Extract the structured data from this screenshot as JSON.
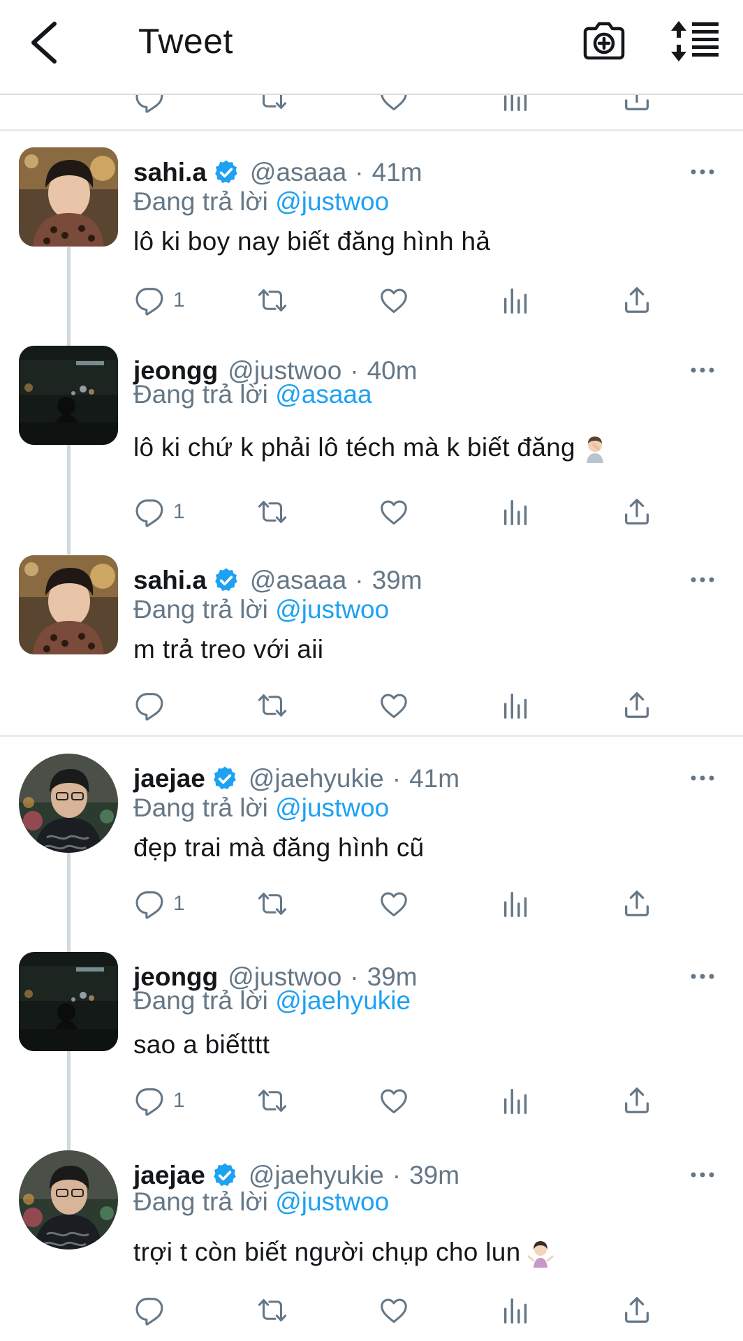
{
  "header": {
    "title": "Tweet"
  },
  "reply_prefix": "Đang trả lời",
  "tweets": [
    {
      "name": "sahi.a",
      "verified": true,
      "handle": "@asaaa",
      "time": "41m",
      "reply_to": "@justwoo",
      "text": "lô ki boy nay biết đăng hình hả",
      "reply_count": "1"
    },
    {
      "name": "jeongg",
      "verified": false,
      "handle": "@justwoo",
      "time": "40m",
      "reply_to": "@asaaa",
      "text": "lô ki chứ k phải lô téch mà k biết đăng",
      "emoji": "facepalm",
      "reply_count": "1"
    },
    {
      "name": "sahi.a",
      "verified": true,
      "handle": "@asaaa",
      "time": "39m",
      "reply_to": "@justwoo",
      "text": "m trả treo với aii",
      "reply_count": ""
    },
    {
      "name": "jaejae",
      "verified": true,
      "handle": "@jaehyukie",
      "time": "41m",
      "reply_to": "@justwoo",
      "text": "đẹp trai mà đăng hình cũ",
      "reply_count": "1"
    },
    {
      "name": "jeongg",
      "verified": false,
      "handle": "@justwoo",
      "time": "39m",
      "reply_to": "@jaehyukie",
      "text": "sao a biếtttt",
      "reply_count": "1"
    },
    {
      "name": "jaejae",
      "verified": true,
      "handle": "@jaehyukie",
      "time": "39m",
      "reply_to": "@justwoo",
      "text": "trợi t còn biết người chụp cho lun",
      "emoji": "shrug",
      "reply_count": ""
    }
  ],
  "icons": {
    "back": "chevron-left-icon",
    "camera": "camera-add-icon",
    "sort": "sort-icon",
    "reply": "reply-icon",
    "retweet": "retweet-icon",
    "like": "heart-icon",
    "analytics": "analytics-icon",
    "share": "share-icon",
    "more": "more-icon",
    "verified": "verified-icon"
  },
  "colors": {
    "link": "#1da1f2",
    "secondary": "#657786",
    "text": "#14171a",
    "divider": "#e6ecf0"
  }
}
